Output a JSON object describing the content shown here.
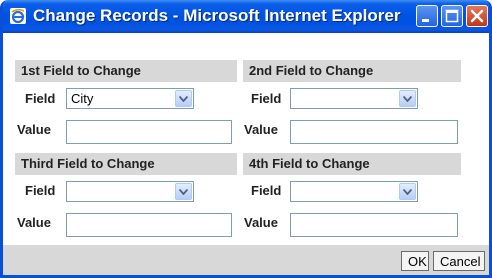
{
  "window": {
    "title": "Change Records - Microsoft Internet Explorer",
    "title_icon": "internet-explorer-icon",
    "controls": [
      "minimize-icon",
      "maximize-icon",
      "close-icon"
    ]
  },
  "labels": {
    "field": "Field",
    "value": "Value"
  },
  "sections": [
    {
      "header": "1st Field to Change",
      "field_value": "City",
      "value": ""
    },
    {
      "header": "2nd Field to Change",
      "field_value": "",
      "value": ""
    },
    {
      "header": "Third Field to Change",
      "field_value": "",
      "value": ""
    },
    {
      "header": "4th Field to Change",
      "field_value": "",
      "value": ""
    }
  ],
  "buttons": {
    "ok": "OK",
    "cancel": "Cancel"
  },
  "colors": {
    "titlebar": "#0054e3",
    "section_header": "#d8d8d8",
    "input_border": "#7f9db9"
  }
}
